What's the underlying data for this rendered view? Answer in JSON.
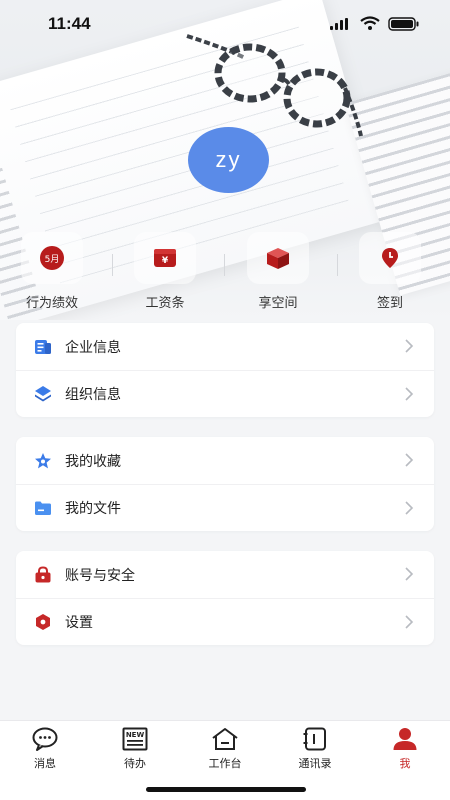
{
  "status_bar": {
    "time": "11:44"
  },
  "profile": {
    "avatar_text": "zy"
  },
  "quick_actions": [
    {
      "label": "行为绩效",
      "icon": "calendar-badge-icon",
      "badge": "5月"
    },
    {
      "label": "工资条",
      "icon": "wallet-icon",
      "badge": "¥"
    },
    {
      "label": "享空间",
      "icon": "box-icon"
    },
    {
      "label": "签到",
      "icon": "clock-pin-icon"
    }
  ],
  "menu_groups": [
    {
      "items": [
        {
          "label": "企业信息",
          "icon": "building-info-icon"
        },
        {
          "label": "组织信息",
          "icon": "layers-icon"
        }
      ]
    },
    {
      "items": [
        {
          "label": "我的收藏",
          "icon": "star-icon"
        },
        {
          "label": "我的文件",
          "icon": "folder-icon"
        }
      ]
    },
    {
      "items": [
        {
          "label": "账号与安全",
          "icon": "lock-icon"
        },
        {
          "label": "设置",
          "icon": "gear-icon"
        }
      ]
    }
  ],
  "tabbar": [
    {
      "label": "消息",
      "icon": "chat-bubble-icon"
    },
    {
      "label": "待办",
      "icon": "todo-news-icon"
    },
    {
      "label": "工作台",
      "icon": "home-icon"
    },
    {
      "label": "通讯录",
      "icon": "contacts-icon"
    },
    {
      "label": "我",
      "icon": "person-icon",
      "active": true
    }
  ],
  "colors": {
    "accent": "#c62828",
    "avatar": "#5a8be8",
    "blue_icon": "#3b7be8"
  }
}
